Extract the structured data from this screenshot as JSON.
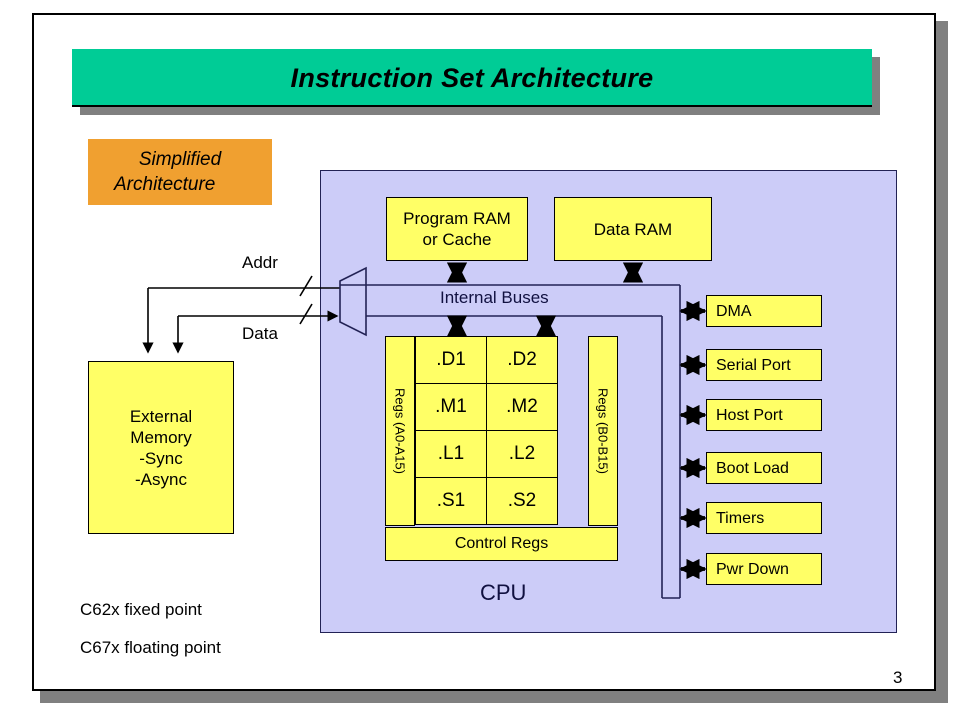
{
  "slide": {
    "title": "Instruction Set Architecture",
    "page_number": "3",
    "accent_green": "#00cc96",
    "accent_orange": "#f0a030",
    "block_yellow": "#ffff66",
    "cpu_lavender": "#ccccf8"
  },
  "callout": {
    "line1": "Simplified",
    "line2": "Architecture"
  },
  "memory": {
    "program_ram_line1": "Program RAM",
    "program_ram_line2": "or Cache",
    "data_ram": "Data RAM",
    "external_line1": "External",
    "external_line2": "Memory",
    "external_line3": "-Sync",
    "external_line4": "-Async"
  },
  "bus": {
    "internal_buses": "Internal Buses",
    "addr_label": "Addr",
    "data_label": "Data"
  },
  "cpu": {
    "label": "CPU",
    "regs_left": "Regs (A0-A15)",
    "regs_right": "Regs (B0-B15)",
    "control_regs": "Control Regs",
    "units": [
      {
        "a": ".D1",
        "b": ".D2"
      },
      {
        "a": ".M1",
        "b": ".M2"
      },
      {
        "a": ".L1",
        "b": ".L2"
      },
      {
        "a": ".S1",
        "b": ".S2"
      }
    ]
  },
  "peripherals": [
    {
      "label": "DMA"
    },
    {
      "label": "Serial Port"
    },
    {
      "label": "Host Port"
    },
    {
      "label": "Boot Load"
    },
    {
      "label": "Timers"
    },
    {
      "label": "Pwr Down"
    }
  ],
  "footnotes": {
    "fixed": "C62x fixed point",
    "floating": "C67x floating point"
  }
}
